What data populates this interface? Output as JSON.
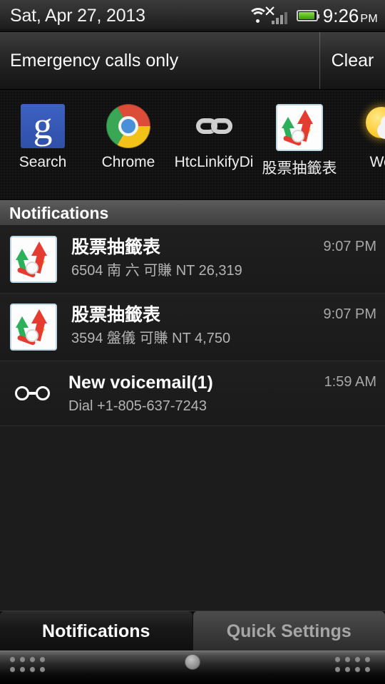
{
  "status_bar": {
    "date": "Sat, Apr 27, 2013",
    "time": "9:26",
    "ampm": "PM",
    "icons": [
      "wifi-icon",
      "no-service-x-icon",
      "signal-bars-icon",
      "battery-icon"
    ]
  },
  "header": {
    "carrier_text": "Emergency calls only",
    "clear_label": "Clear"
  },
  "recent_apps": [
    {
      "label": "Search",
      "icon": "google-search-icon"
    },
    {
      "label": "Chrome",
      "icon": "chrome-icon"
    },
    {
      "label": "HtcLinkifyDi",
      "icon": "chain-link-icon"
    },
    {
      "label": "股票抽籤表",
      "icon": "stock-app-icon"
    },
    {
      "label": "Wea",
      "icon": "weather-sun-cloud-icon"
    }
  ],
  "notifications_section": {
    "title": "Notifications",
    "items": [
      {
        "icon": "stock-app-icon",
        "title": "股票抽籤表",
        "subtitle": "6504 南 六 可賺 NT 26,319",
        "time": "9:07 PM"
      },
      {
        "icon": "stock-app-icon",
        "title": "股票抽籤表",
        "subtitle": "3594 盤儀 可賺 NT 4,750",
        "time": "9:07 PM"
      },
      {
        "icon": "voicemail-icon",
        "title": "New voicemail(1)",
        "subtitle": "Dial +1-805-637-7243",
        "time": "1:59 AM"
      }
    ]
  },
  "tabs": [
    {
      "label": "Notifications",
      "active": true
    },
    {
      "label": "Quick Settings",
      "active": false
    }
  ],
  "colors": {
    "battery_green": "#54b81b",
    "panel_background": "#1c1c1c",
    "section_header": "#4b4b4b",
    "active_tab_text": "#ffffff",
    "inactive_tab_text": "#a6a6a6"
  }
}
